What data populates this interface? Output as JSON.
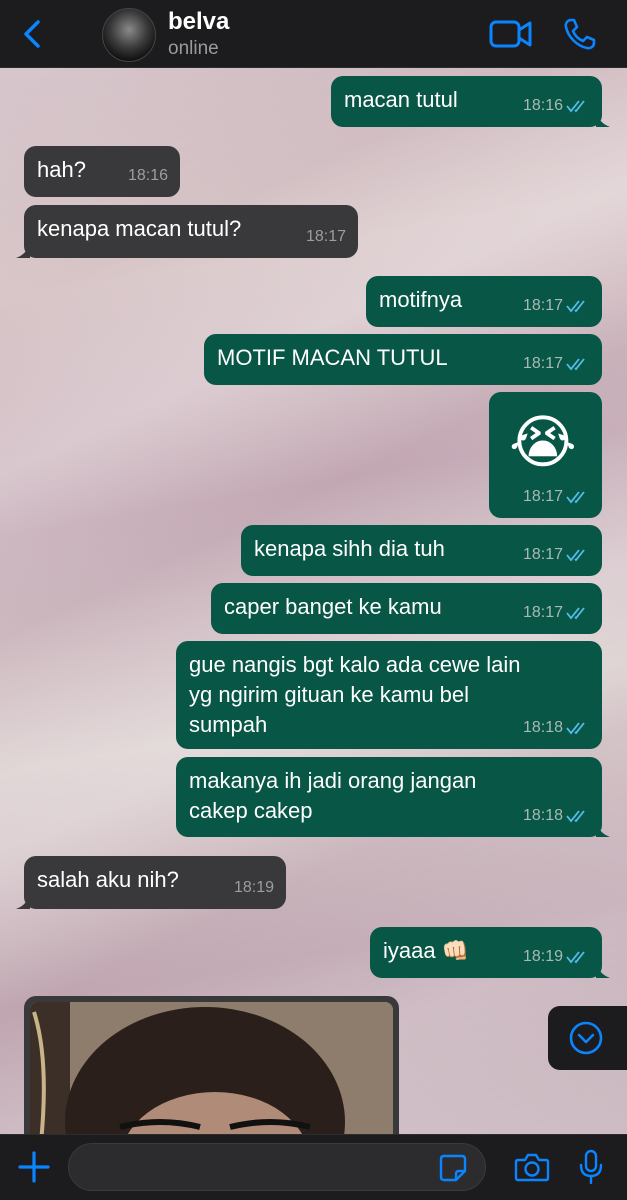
{
  "header": {
    "contact_name": "belva",
    "status": "online"
  },
  "messages": [
    {
      "dir": "out",
      "text": "macan tutul",
      "time": "18:16",
      "read": true
    },
    {
      "dir": "in",
      "text": "hah?",
      "time": "18:16"
    },
    {
      "dir": "in",
      "text": "kenapa macan tutul?",
      "time": "18:17"
    },
    {
      "dir": "out",
      "text": "motifnya",
      "time": "18:17",
      "read": true
    },
    {
      "dir": "out",
      "text": "MOTIF MACAN TUTUL",
      "time": "18:17",
      "read": true
    },
    {
      "dir": "out",
      "text": "😭",
      "time": "18:17",
      "read": true
    },
    {
      "dir": "out",
      "text": "kenapa sihh dia tuh",
      "time": "18:17",
      "read": true
    },
    {
      "dir": "out",
      "text": "caper banget ke kamu",
      "time": "18:17",
      "read": true
    },
    {
      "dir": "out",
      "text": "gue nangis bgt kalo ada cewe lain\nyg ngirim gituan ke kamu bel\nsumpah",
      "time": "18:18",
      "read": true
    },
    {
      "dir": "out",
      "text": "makanya ih jadi orang jangan\ncakep cakep",
      "time": "18:18",
      "read": true
    },
    {
      "dir": "in",
      "text": "salah aku nih?",
      "time": "18:19"
    },
    {
      "dir": "out",
      "text": "iyaaa 👊🏻",
      "time": "18:19",
      "read": true
    }
  ],
  "input": {
    "placeholder": ""
  },
  "colors": {
    "accent": "#0a84ff",
    "outgoing_bubble": "#075646",
    "incoming_bubble": "#39393b",
    "read_ticks": "#53bdeb"
  },
  "icons": [
    "back-chevron-icon",
    "video-call-icon",
    "phone-icon",
    "scroll-down-icon",
    "plus-icon",
    "sticker-icon",
    "camera-icon",
    "microphone-icon"
  ]
}
